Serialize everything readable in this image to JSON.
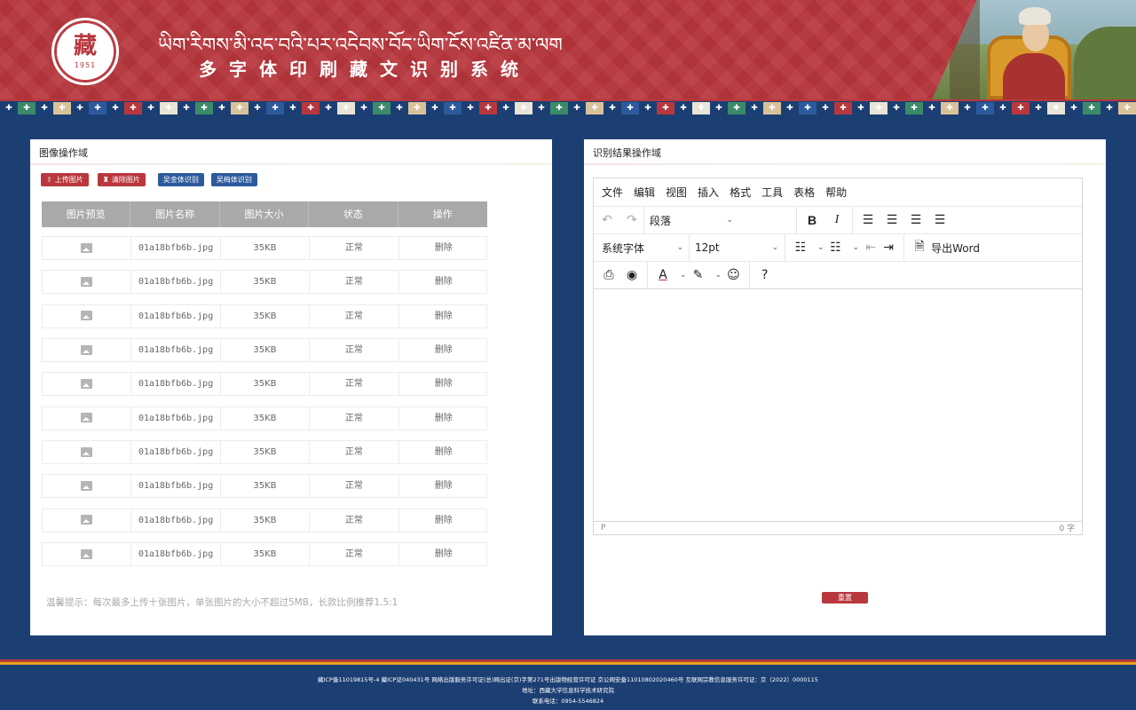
{
  "header": {
    "title_tibetan": "ཡིག་རིགས་མི་འདྲ་བའི་པར་འདེབས་བོད་ཡིག་ངོས་འཛིན་མ་ལག",
    "title_cn": "多字体印刷藏文识别系统",
    "logo": {
      "glyph": "藏",
      "year": "1951"
    }
  },
  "left_panel": {
    "title": "图像操作域",
    "buttons": {
      "upload": "上传图片",
      "clear": "清除图片",
      "wujin": "吴金体识别",
      "wumei": "吴梅体识别"
    },
    "columns": [
      "图片预览",
      "图片名称",
      "图片大小",
      "状态",
      "操作"
    ],
    "rows": [
      {
        "name": "01a18bfb6b.jpg",
        "size": "35KB",
        "status": "正常",
        "action": "删除"
      },
      {
        "name": "01a18bfb6b.jpg",
        "size": "35KB",
        "status": "正常",
        "action": "删除"
      },
      {
        "name": "01a18bfb6b.jpg",
        "size": "35KB",
        "status": "正常",
        "action": "删除"
      },
      {
        "name": "01a18bfb6b.jpg",
        "size": "35KB",
        "status": "正常",
        "action": "删除"
      },
      {
        "name": "01a18bfb6b.jpg",
        "size": "35KB",
        "status": "正常",
        "action": "删除"
      },
      {
        "name": "01a18bfb6b.jpg",
        "size": "35KB",
        "status": "正常",
        "action": "删除"
      },
      {
        "name": "01a18bfb6b.jpg",
        "size": "35KB",
        "status": "正常",
        "action": "删除"
      },
      {
        "name": "01a18bfb6b.jpg",
        "size": "35KB",
        "status": "正常",
        "action": "删除"
      },
      {
        "name": "01a18bfb6b.jpg",
        "size": "35KB",
        "status": "正常",
        "action": "删除"
      },
      {
        "name": "01a18bfb6b.jpg",
        "size": "35KB",
        "status": "正常",
        "action": "删除"
      }
    ],
    "tip": "温馨提示：每次最多上传十张图片，单张图片的大小不超过5MB，长款比例推荐1.5:1"
  },
  "right_panel": {
    "title": "识别结果操作域",
    "menu": [
      "文件",
      "编辑",
      "视图",
      "插入",
      "格式",
      "工具",
      "表格",
      "帮助"
    ],
    "block_select": "段落",
    "font_select": "系统字体",
    "size_select": "12pt",
    "export_label": "导出Word",
    "status_path": "P",
    "word_count": "0 字",
    "reset_label": "重置"
  },
  "footer": {
    "line1": "藏ICP备11019815号-4 藏ICP证040431号 网络出版服务许可证(总)网出证(京)字第271号出版物经营许可证 京公网安备11010802020460号   互联网宗教信息服务许可证：京（2022）0000115",
    "line2": "地址：西藏大学信息科学技术研究院",
    "line3": "联系电话：0954-5546824"
  },
  "colors": {
    "brand_red": "#b8373d",
    "brand_blue": "#1c3f73",
    "button_blue": "#2c5a9c",
    "table_header": "#a9a9a9"
  }
}
